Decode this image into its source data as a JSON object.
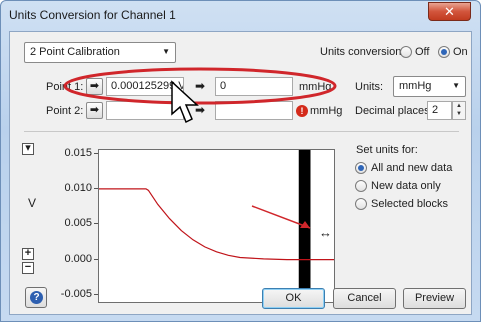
{
  "window": {
    "title": "Units Conversion for Channel 1",
    "close_glyph": "✕"
  },
  "calibration": {
    "mode_selected": "2 Point Calibration",
    "units_conversion_label": "Units conversion:",
    "off_label": "Off",
    "on_label": "On",
    "selected": "On"
  },
  "points": {
    "point1_label": "Point 1:",
    "point1_value": "0.000125299 V",
    "point1_target": "0",
    "point1_units": "mmHg",
    "point2_label": "Point 2:",
    "point2_value": "",
    "point2_target": "",
    "point2_units": "mmHg"
  },
  "units": {
    "units_label": "Units:",
    "units_value": "mmHg",
    "decimal_label": "Decimal places:",
    "decimal_value": "2"
  },
  "set_units": {
    "heading": "Set units for:",
    "options": [
      "All and new data",
      "New data only",
      "Selected blocks"
    ],
    "selected": "All and new data"
  },
  "chart_data": {
    "type": "line",
    "ylabel": "V",
    "ylim": [
      -0.006,
      0.0155
    ],
    "yticks": [
      "0.015",
      "0.010",
      "0.005",
      "0.000",
      "-0.005"
    ],
    "ytick_values": [
      0.015,
      0.01,
      0.005,
      0.0,
      -0.005
    ],
    "series": [
      {
        "color": "#c0141a",
        "points": [
          [
            0.0,
            0.01
          ],
          [
            0.2,
            0.01
          ],
          [
            0.21,
            0.0098
          ],
          [
            0.25,
            0.0078
          ],
          [
            0.3,
            0.0058
          ],
          [
            0.35,
            0.0041
          ],
          [
            0.4,
            0.0028
          ],
          [
            0.45,
            0.0018
          ],
          [
            0.5,
            0.0011
          ],
          [
            0.55,
            0.0006
          ],
          [
            0.6,
            0.0003
          ],
          [
            0.7,
            0.0001
          ],
          [
            0.8,
            0.0
          ],
          [
            0.87,
            0.0
          ],
          [
            0.92,
            0.0
          ],
          [
            1.0,
            0.0
          ]
        ]
      }
    ],
    "marker_band": {
      "x0": 0.85,
      "x1": 0.9,
      "color": "#000000"
    }
  },
  "buttons": {
    "ok": "OK",
    "cancel": "Cancel",
    "preview": "Preview",
    "help_glyph": "?"
  },
  "annotation": {
    "highlight_color": "#d0262b",
    "arrow_color": "#d0262b"
  }
}
